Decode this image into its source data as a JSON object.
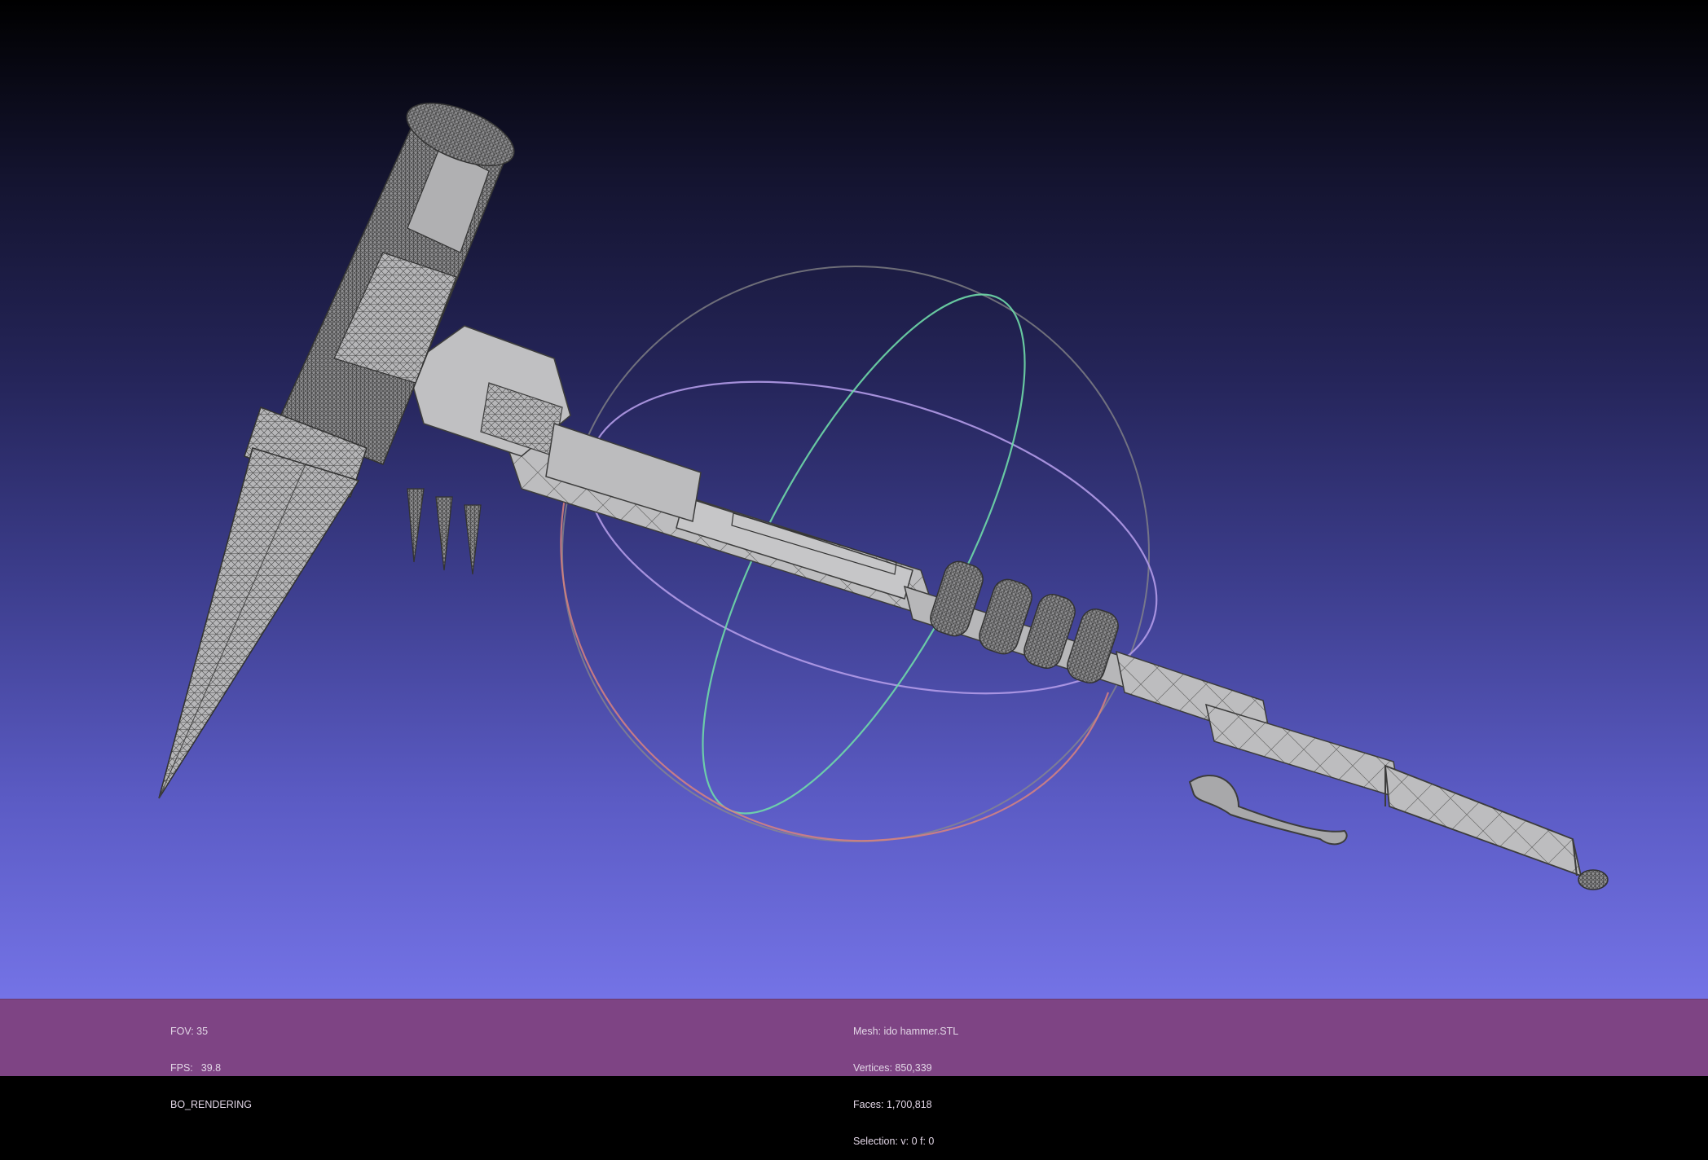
{
  "viewport": {
    "background_top": "#000000",
    "background_bottom": "#7473e6",
    "mesh_fill": "#b9b9bb",
    "wire_color": "#3c3c3c",
    "trackball_colors": {
      "ring_x": "#6fd9a8",
      "ring_y": "#b39be8",
      "ring_z": "#d9827e",
      "ring_outer": "#8a8a8a"
    }
  },
  "status": {
    "fov_label": "FOV: 35",
    "fps_label": "FPS:",
    "fps_value": "39.8",
    "render_mode": "BO_RENDERING",
    "mesh": "Mesh: ido hammer.STL",
    "vertices": "Vertices: 850,339",
    "faces": "Faces: 1,700,818",
    "selection": "Selection: v: 0 f: 0",
    "bar_color": "#7e4484"
  }
}
